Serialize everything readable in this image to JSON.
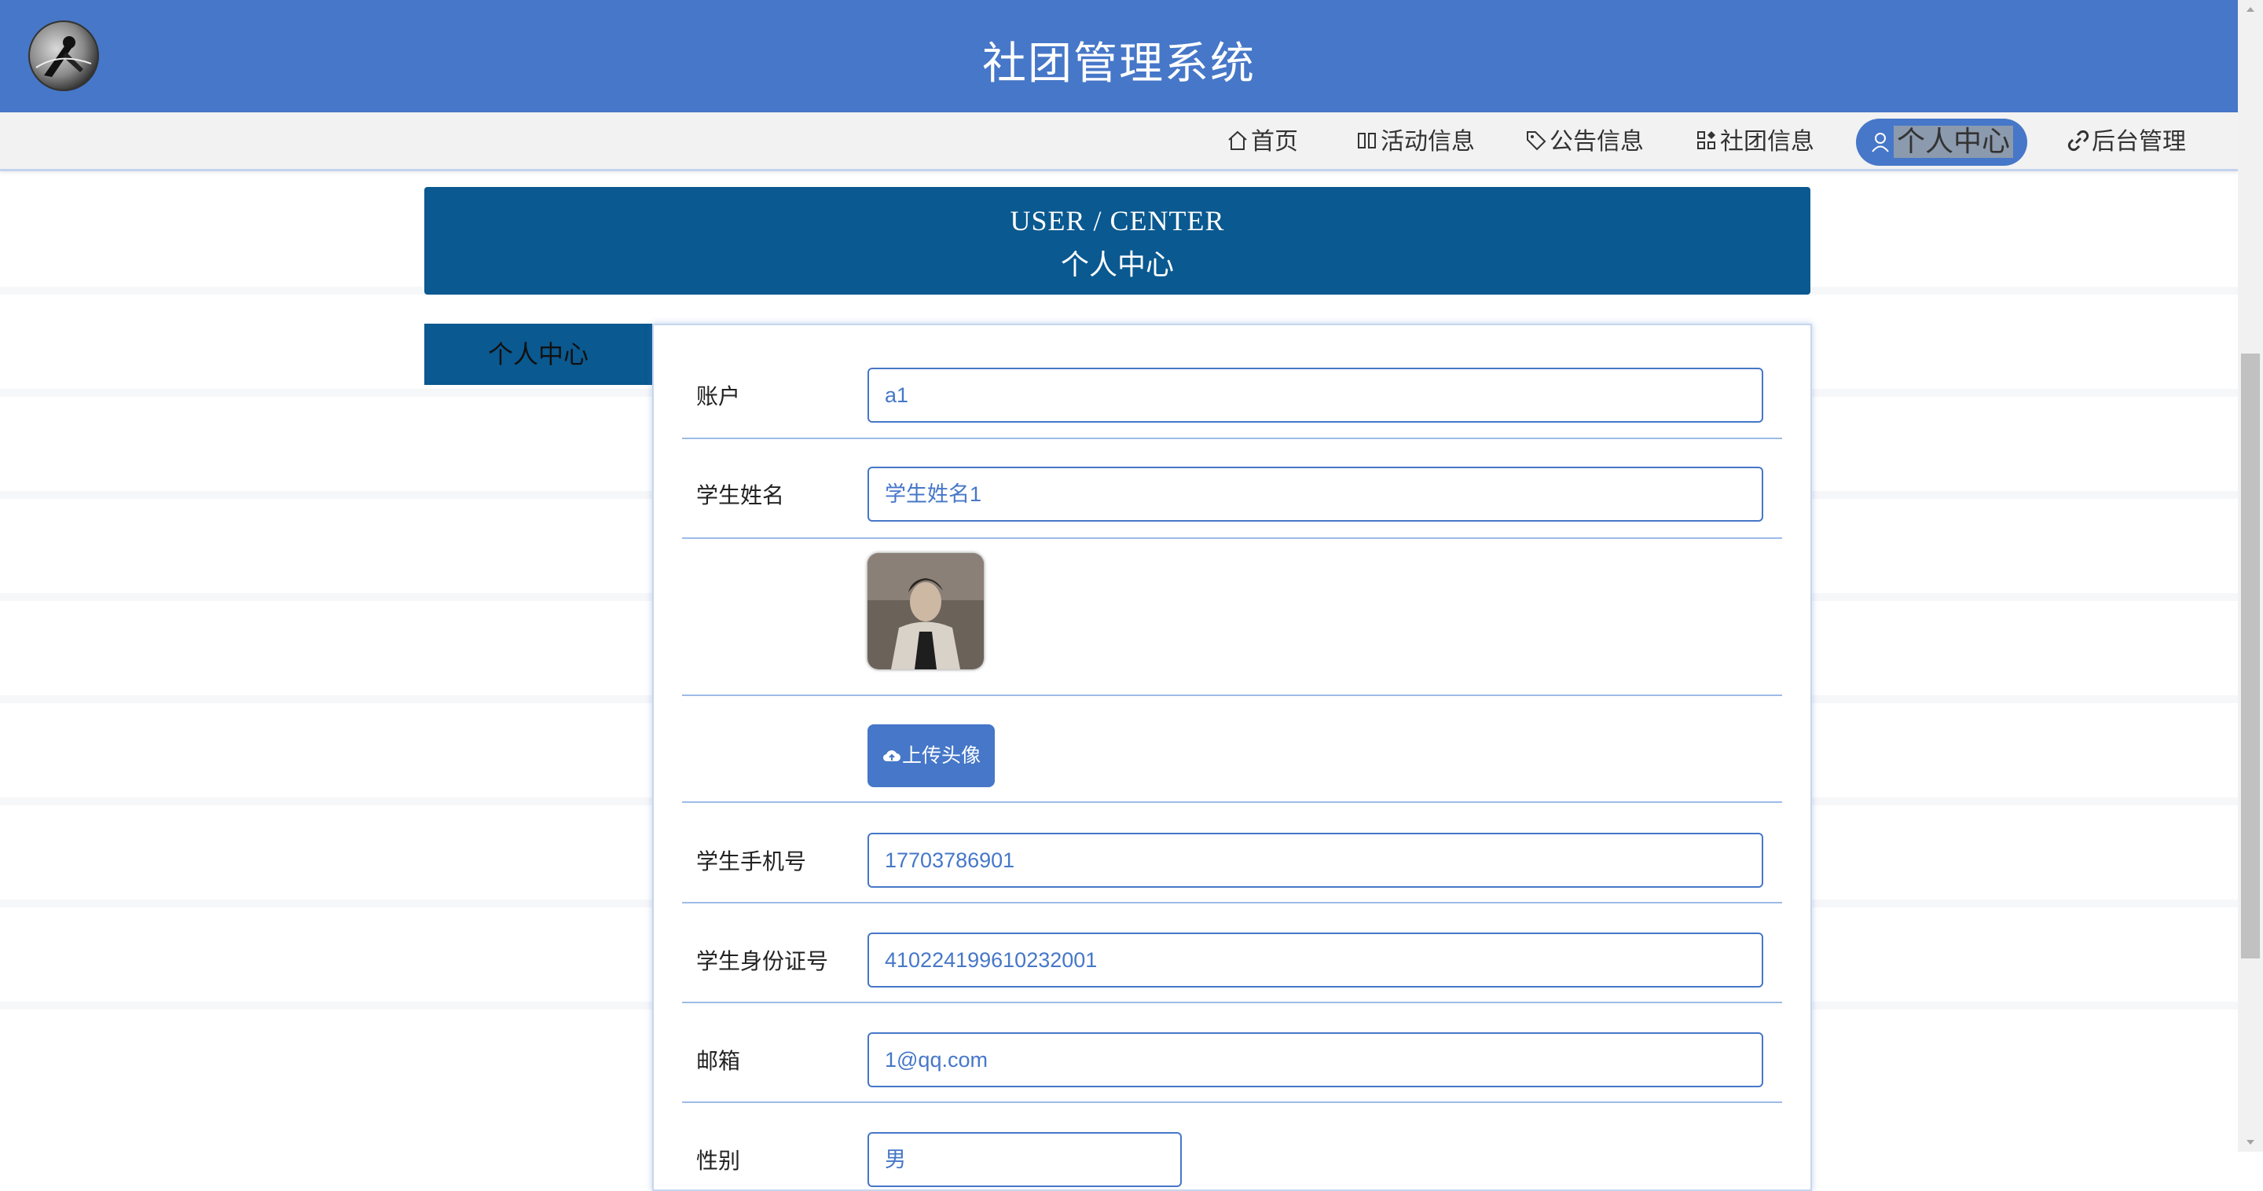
{
  "header": {
    "title": "社团管理系统"
  },
  "nav": {
    "items": [
      {
        "label": "首页",
        "icon": "home-icon"
      },
      {
        "label": "活动信息",
        "icon": "columns-icon"
      },
      {
        "label": "公告信息",
        "icon": "tag-icon"
      },
      {
        "label": "社团信息",
        "icon": "grid-icon"
      },
      {
        "label": "个人中心",
        "icon": "user-icon",
        "active": true
      },
      {
        "label": "后台管理",
        "icon": "link-icon"
      }
    ]
  },
  "banner": {
    "en": "USER / CENTER",
    "zh": "个人中心"
  },
  "sidebar": {
    "items": [
      {
        "label": "个人中心"
      }
    ]
  },
  "form": {
    "account": {
      "label": "账户",
      "value": "a1"
    },
    "student_name": {
      "label": "学生姓名",
      "value": "学生姓名1"
    },
    "avatar": {
      "icon": "avatar-photo"
    },
    "upload": {
      "label": "上传头像",
      "icon": "cloud-upload-icon"
    },
    "phone": {
      "label": "学生手机号",
      "value": "17703786901"
    },
    "id_number": {
      "label": "学生身份证号",
      "value": "410224199610232001"
    },
    "email": {
      "label": "邮箱",
      "value": "1@qq.com"
    },
    "gender": {
      "label": "性别",
      "value": "男"
    }
  },
  "colors": {
    "header_bg": "#4677c8",
    "banner_bg": "#0a5990",
    "input_border": "#4677c8",
    "nav_bg": "#f2f2f2"
  }
}
